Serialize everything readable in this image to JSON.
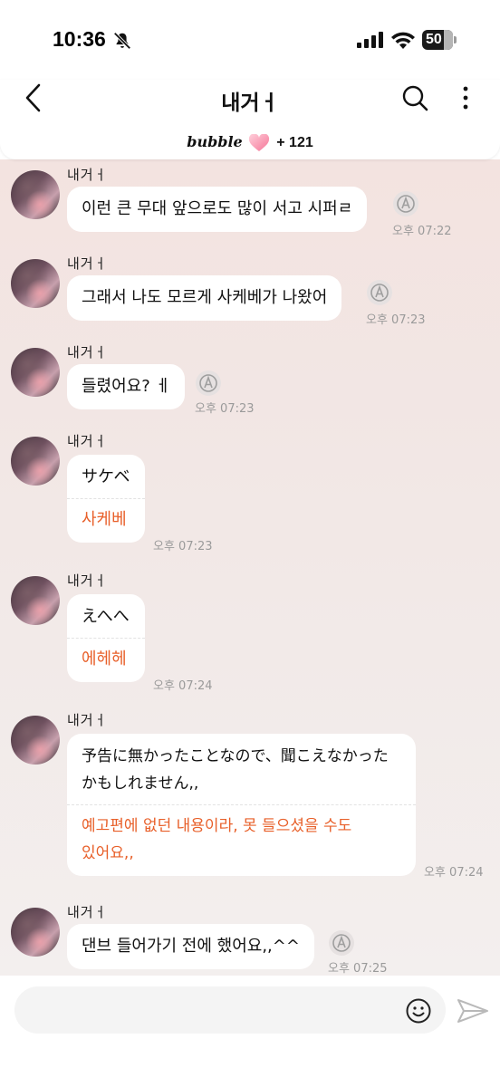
{
  "status_bar": {
    "time": "10:36",
    "battery": "50",
    "icons": [
      "bell-slash-icon",
      "signal-icon",
      "wifi-icon",
      "battery-icon"
    ]
  },
  "header": {
    "title": "내거ㅓ",
    "brand": "bubble",
    "count": "+ 121",
    "icons": [
      "back-chevron-icon",
      "search-icon",
      "more-vertical-icon",
      "heart-icon"
    ]
  },
  "messages": [
    {
      "sender": "내거ㅓ",
      "text": "이런 큰 무대 앞으로도 많이 서고 시퍼ㄹ",
      "time": "오후 07:22"
    },
    {
      "sender": "내거ㅓ",
      "text": "그래서 나도 모르게 사케베가 나왔어",
      "time": "오후 07:23"
    },
    {
      "sender": "내거ㅓ",
      "text": "들렸어요? ㅔ",
      "time": "오후 07:23"
    },
    {
      "sender": "내거ㅓ",
      "original": "サケベ",
      "translation": "사케베",
      "time": "오후 07:23"
    },
    {
      "sender": "내거ㅓ",
      "original": "えへへ",
      "translation": "에헤헤",
      "time": "오후 07:24"
    },
    {
      "sender": "내거ㅓ",
      "original_lines": [
        "予告に無かったことなので、聞こえなかった",
        "かもしれません,,"
      ],
      "translation_lines": [
        "예고편에 없던 내용이라, 못 들으셨을 수도",
        "있어요,,"
      ],
      "time": "오후 07:24"
    },
    {
      "sender": "내거ㅓ",
      "text": "댄브 들어가기 전에 했어요,,^^",
      "time": "오후 07:25"
    }
  ],
  "input": {
    "placeholder": "",
    "icons": [
      "smiley-icon",
      "send-icon"
    ]
  },
  "colors": {
    "accent_translation": "#e8602a",
    "chat_bg_top": "#f3e3e0",
    "chat_bg_bottom": "#f3efee",
    "bubble": "#ffffff",
    "timestamp": "#9a9a9a"
  }
}
